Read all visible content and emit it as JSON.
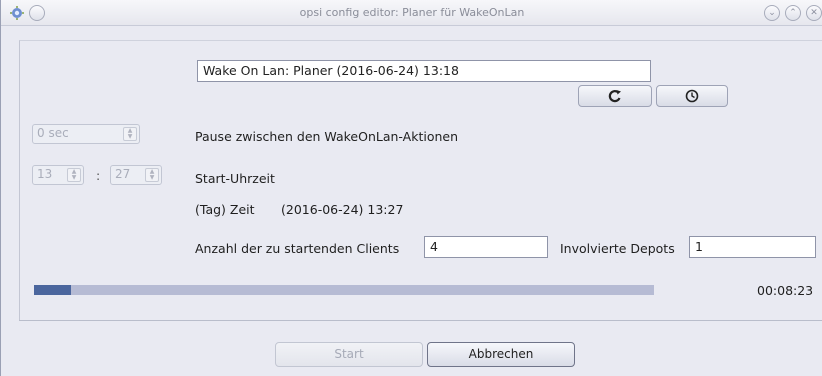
{
  "window": {
    "title": "opsi config editor: Planer für WakeOnLan"
  },
  "planner": {
    "title_value": "Wake On Lan: Planer  (2016-06-24) 13:18",
    "pause_value": "0 sec",
    "pause_label": "Pause zwischen den WakeOnLan-Aktionen",
    "hour_value": "13",
    "time_separator": ":",
    "minute_value": "27",
    "start_time_label": "Start-Uhrzeit",
    "day_time_label": "(Tag) Zeit",
    "day_time_value": "(2016-06-24) 13:27",
    "clients_label": "Anzahl der zu startenden Clients",
    "clients_value": "4",
    "depots_label": "Involvierte Depots",
    "depots_value": "1",
    "progress_fraction": 0.06,
    "elapsed_time": "00:08:23"
  },
  "buttons": {
    "start_label": "Start",
    "cancel_label": "Abbrechen"
  },
  "colors": {
    "background": "#e9eaf2",
    "progress_track": "#b6bbd4",
    "progress_fill": "#4b669e"
  },
  "icons": {
    "refresh": "refresh-icon",
    "clock": "clock-icon"
  }
}
